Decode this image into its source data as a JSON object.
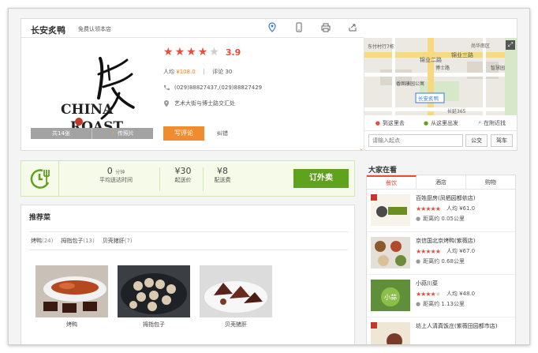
{
  "header": {
    "name": "长安炙鸭",
    "claim_link": "免费认领本店"
  },
  "restaurant": {
    "rating": "3.9",
    "stars": [
      true,
      true,
      true,
      true,
      false
    ],
    "avg_label": "人均",
    "avg_value": "¥108.0",
    "review_label": "评论",
    "review_count": "30",
    "phone": "(029)88827437,(029)88827429",
    "address": "艺术大街与博士路交汇处",
    "logo_text_top": "CHINA",
    "logo_text_bottom": "ROAST",
    "photos_label": "共14张",
    "upload_label": "传照片",
    "write_review": "写评论",
    "report_error": "纠错"
  },
  "map": {
    "labels": [
      "东付村行7栋",
      "锦业二路",
      "尚华南区",
      "锦业三路",
      "博士路",
      "智慧园",
      "香图康园公寓",
      "长安炙鸭",
      "长延365"
    ],
    "tabs": [
      "到这里去",
      "从这里出发",
      "在附近找"
    ],
    "search_placeholder": "请输入起点",
    "transit_btn": "公交",
    "drive_btn": "驾车"
  },
  "delivery": {
    "time_value": "0",
    "time_unit": "分钟",
    "time_label": "平均送达时间",
    "min_value": "¥30",
    "min_label": "起送价",
    "fee_value": "¥8",
    "fee_label": "配送费",
    "order_btn": "订外卖"
  },
  "recommended": {
    "title": "推荐菜",
    "tags": [
      {
        "name": "烤鸭",
        "count": "(24)"
      },
      {
        "name": "拇指包子",
        "count": "(13)"
      },
      {
        "name": "贝壳猪肝",
        "count": "(7)"
      }
    ],
    "dishes": [
      "烤鸭",
      "拇指包子",
      "贝壳猪肝"
    ]
  },
  "sidebar": {
    "title": "大家在看",
    "tabs": [
      "餐饮",
      "酒店",
      "购物"
    ],
    "items": [
      {
        "name": "百姓厨房(凤栖园都依店)",
        "stars": 5,
        "avg": "人均 ¥61.0",
        "distance": "距离约 0.05公里"
      },
      {
        "name": "京信国北京烤鸭(紫薇店)",
        "stars": 5,
        "avg": "人均 ¥67.0",
        "distance": "距离约 0.68公里"
      },
      {
        "name": "小蒜川菜",
        "stars": 4,
        "avg": "人均 ¥48.0",
        "distance": "距离约 1.13公里"
      },
      {
        "name": "坊上人清真饭庄(紫薇田园都市店)",
        "stars": 0,
        "avg": "",
        "distance": ""
      }
    ]
  },
  "colors": {
    "accent_red": "#e74c3c",
    "orange": "#f08c2e",
    "green": "#5fa21e"
  }
}
